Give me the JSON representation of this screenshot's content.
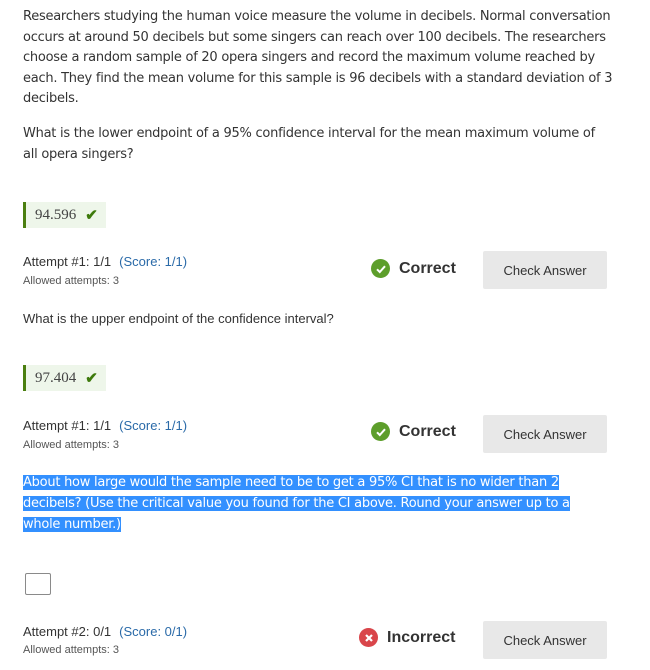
{
  "intro_text": "Researchers studying the human voice measure the volume in decibels. Normal conversation occurs at around 50 decibels but some singers can reach over 100 decibels. The researchers choose a random sample of 20 opera singers and record the maximum volume reached by each. They find the mean volume for this sample is 96 decibels with a standard deviation of 3 decibels.",
  "questions": [
    {
      "prompt": "What is the lower endpoint of a 95% confidence interval for the mean maximum volume of all opera singers?",
      "answer": "94.596",
      "attempt": "Attempt #1: 1/1",
      "score": "(Score: 1/1)",
      "allowed": "Allowed attempts: 3",
      "status": "Correct",
      "button": "Check Answer"
    },
    {
      "prompt": "What is the upper endpoint of the confidence interval?",
      "answer": "97.404",
      "attempt": "Attempt #1: 1/1",
      "score": "(Score: 1/1)",
      "allowed": "Allowed attempts: 3",
      "status": "Correct",
      "button": "Check Answer"
    },
    {
      "prompt_lines": [
        "About how large would the sample need to be to get a 95% CI that is no wider than 2",
        "decibels? (Use the critical value you found for the CI above. Round your answer up to a",
        "whole number.)"
      ],
      "answer": "",
      "attempt": "Attempt #2: 0/1",
      "score": "(Score: 0/1)",
      "allowed": "Allowed attempts: 3",
      "status": "Incorrect",
      "button": "Check Answer"
    }
  ],
  "colors": {
    "correct": "#5d9e2b",
    "incorrect": "#d9454a",
    "score_link": "#2a6aa8",
    "selection": "#3390ff"
  }
}
